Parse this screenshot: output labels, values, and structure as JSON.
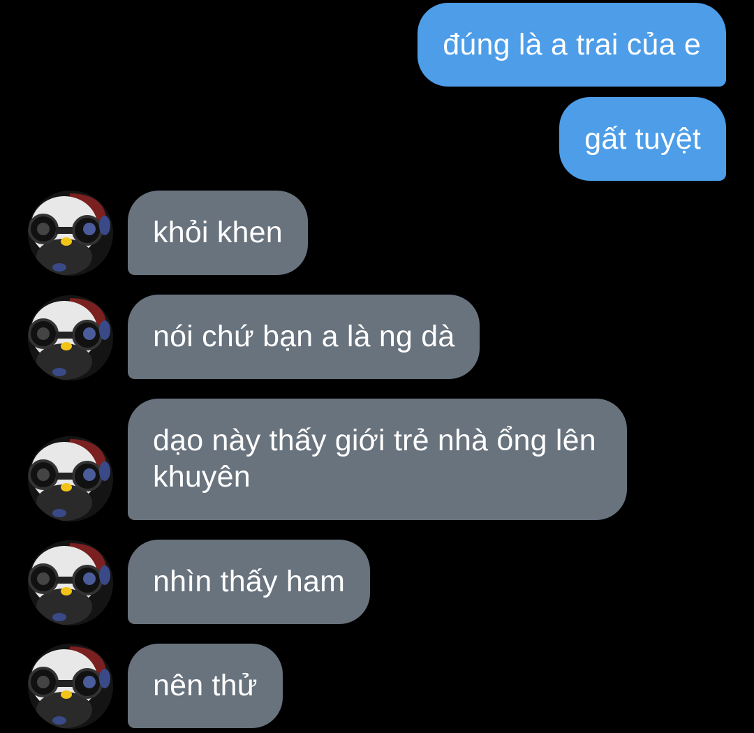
{
  "messages": {
    "sent": [
      {
        "text": "đúng là a trai của e"
      },
      {
        "text": "gất tuyệt"
      }
    ],
    "received": [
      {
        "text": "khỏi khen"
      },
      {
        "text": "nói chứ bạn a là ng dà"
      },
      {
        "text": "dạo này thấy giới trẻ nhà ổng lên khuyên"
      },
      {
        "text": "nhìn thấy ham"
      },
      {
        "text": "nên thử"
      }
    ]
  },
  "colors": {
    "background": "#000000",
    "sent_bubble": "#4d9de8",
    "received_bubble": "#69737e",
    "text": "#ffffff"
  },
  "icons": {
    "avatar": "penguin-avatar-icon"
  }
}
